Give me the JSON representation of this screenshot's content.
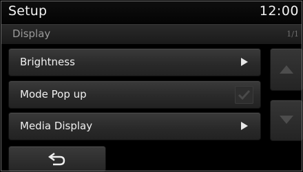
{
  "header": {
    "title": "Setup",
    "clock": "12:00"
  },
  "subheader": {
    "title": "Display",
    "page_indicator": "1/1"
  },
  "menu": {
    "items": [
      {
        "label": "Brightness",
        "control": "arrow-right-icon"
      },
      {
        "label": "Mode Pop up",
        "control": "checkbox",
        "checked": true,
        "enabled": false
      },
      {
        "label": "Media Display",
        "control": "arrow-right-icon"
      }
    ]
  },
  "scroll": {
    "up_icon": "triangle-up-icon",
    "down_icon": "triangle-down-icon",
    "up_enabled": false,
    "down_enabled": false
  },
  "footer": {
    "back_icon": "back-arrow-icon"
  },
  "colors": {
    "background": "#000000",
    "text": "#f0f0f0",
    "subtext": "#9a9a9a",
    "button": "#2e2e2e",
    "disabled_icon": "#4d4d4d"
  }
}
